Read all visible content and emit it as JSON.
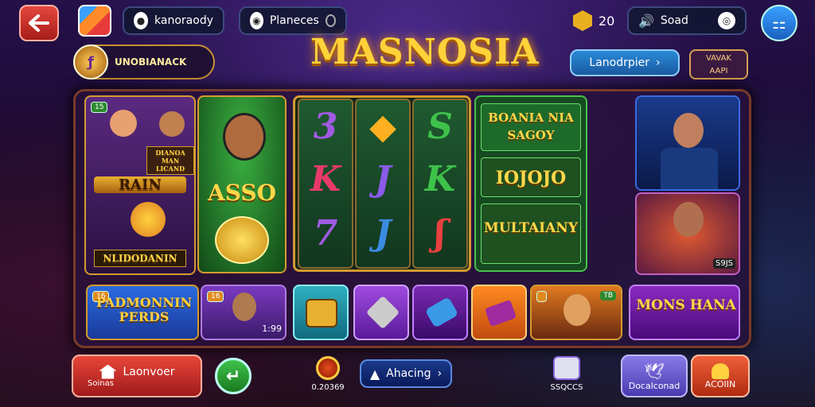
{
  "header": {
    "profile_text": "kanoraody",
    "planets_text": "Planeces",
    "coin_count": "20",
    "sound_label": "Soad",
    "title": "MASNOSIA",
    "badge_text": "UNOBIANACK",
    "nav_label": "Lanodrpier",
    "vip_line1": "VAVAK",
    "vip_line2": "AAPI"
  },
  "tiles": {
    "left_top_badge": "15",
    "left_sign": "DIANOA MAN LICAND",
    "left_rain": "RAIN",
    "left_bottom": "NLIDODANIN",
    "featured": "ASSO",
    "right_top": "BOANIA NIA SAGOY",
    "right_mid": "IOJOJO",
    "right_low": "MULTAIANY",
    "side_badge": "S9JS"
  },
  "reels": {
    "col1": [
      "3",
      "K",
      "7"
    ],
    "col2": [
      "◆",
      "J",
      "J"
    ],
    "col3": [
      "S",
      "K",
      "ʃ"
    ],
    "colors": {
      "c1": "#9a4ad8",
      "c2": "#3a8ae0",
      "c3": "#3ec24a"
    }
  },
  "bottom_row": {
    "promo": "PADMONNIN PERDS",
    "promo_badge": "16",
    "hero_badge": "16",
    "hero_value": "1:99",
    "girl_badge": "TB",
    "monster": "MONS HANA"
  },
  "footer": {
    "home_label": "Laonvoer",
    "home_sub": "Soinas",
    "coin_total": "0.20369",
    "action_label": "Ahacing",
    "scores_label": "SSQCCS",
    "friends_label": "Docalconad",
    "account_label": "ACOIIN"
  }
}
